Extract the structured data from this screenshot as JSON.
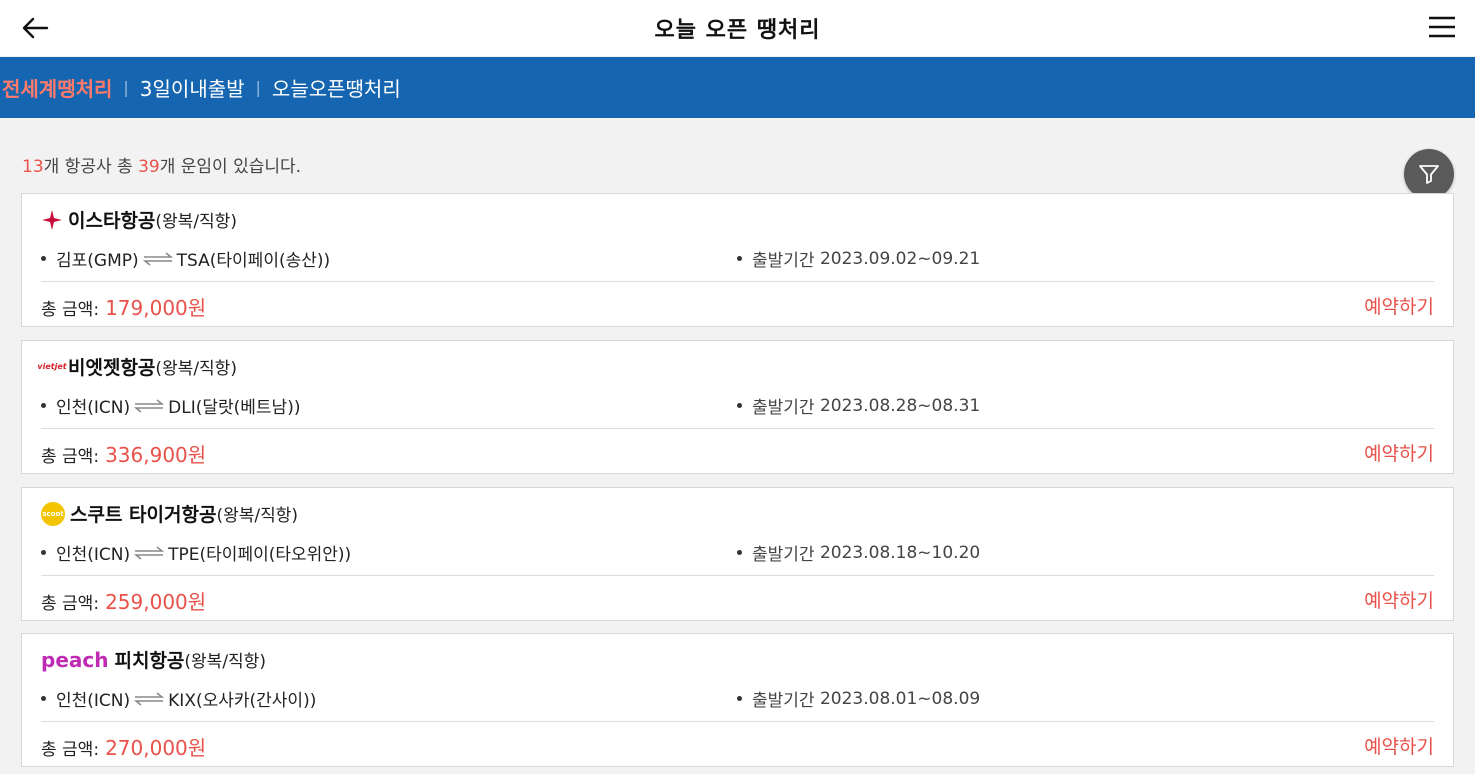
{
  "header": {
    "title": "오늘 오픈 땡처리",
    "back_icon": "arrow-left-icon",
    "menu_icon": "hamburger-menu-icon"
  },
  "tabs": [
    {
      "label": "전세계땡처리",
      "active": true
    },
    {
      "label": "3일이내출발",
      "active": false
    },
    {
      "label": "오늘오픈땡처리",
      "active": false
    }
  ],
  "tab_separator": "|",
  "summary": {
    "airlines_count": "13",
    "airlines_text": "개 항공사 총 ",
    "fares_count": "39",
    "fares_text": "개 운임이 있습니다."
  },
  "filter": {
    "icon": "filter-funnel-icon"
  },
  "colors": {
    "accent": "#e8524a",
    "tabbar": "#1565b0",
    "active_tab": "#ff7a6b"
  },
  "cards": [
    {
      "logo_icon": "eastar-star-icon",
      "airline": "이스타항공",
      "type": "(왕복/직항)",
      "origin": "김포(GMP)",
      "destination": "TSA(타이페이(송산))",
      "period_label": "출발기간",
      "period": "2023.09.02~09.21",
      "price_label": "총 금액:",
      "price": "179,000원",
      "reserve": "예약하기"
    },
    {
      "logo_icon": "vietjet-logo-icon",
      "logo_text": "vietjet",
      "airline": "비엣젯항공",
      "type": "(왕복/직항)",
      "origin": "인천(ICN)",
      "destination": "DLI(달랏(베트남))",
      "period_label": "출발기간",
      "period": "2023.08.28~08.31",
      "price_label": "총 금액:",
      "price": "336,900원",
      "reserve": "예약하기"
    },
    {
      "logo_icon": "scoot-logo-icon",
      "logo_text": "scoot",
      "airline": "스쿠트 타이거항공",
      "type": "(왕복/직항)",
      "origin": "인천(ICN)",
      "destination": "TPE(타이페이(타오위안))",
      "period_label": "출발기간",
      "period": "2023.08.18~10.20",
      "price_label": "총 금액:",
      "price": "259,000원",
      "reserve": "예약하기"
    },
    {
      "logo_icon": "peach-logo-icon",
      "logo_text": "peach",
      "airline": "피치항공",
      "type": "(왕복/직항)",
      "origin": "인천(ICN)",
      "destination": "KIX(오사카(간사이))",
      "period_label": "출발기간",
      "period": "2023.08.01~08.09",
      "price_label": "총 금액:",
      "price": "270,000원",
      "reserve": "예약하기"
    }
  ]
}
